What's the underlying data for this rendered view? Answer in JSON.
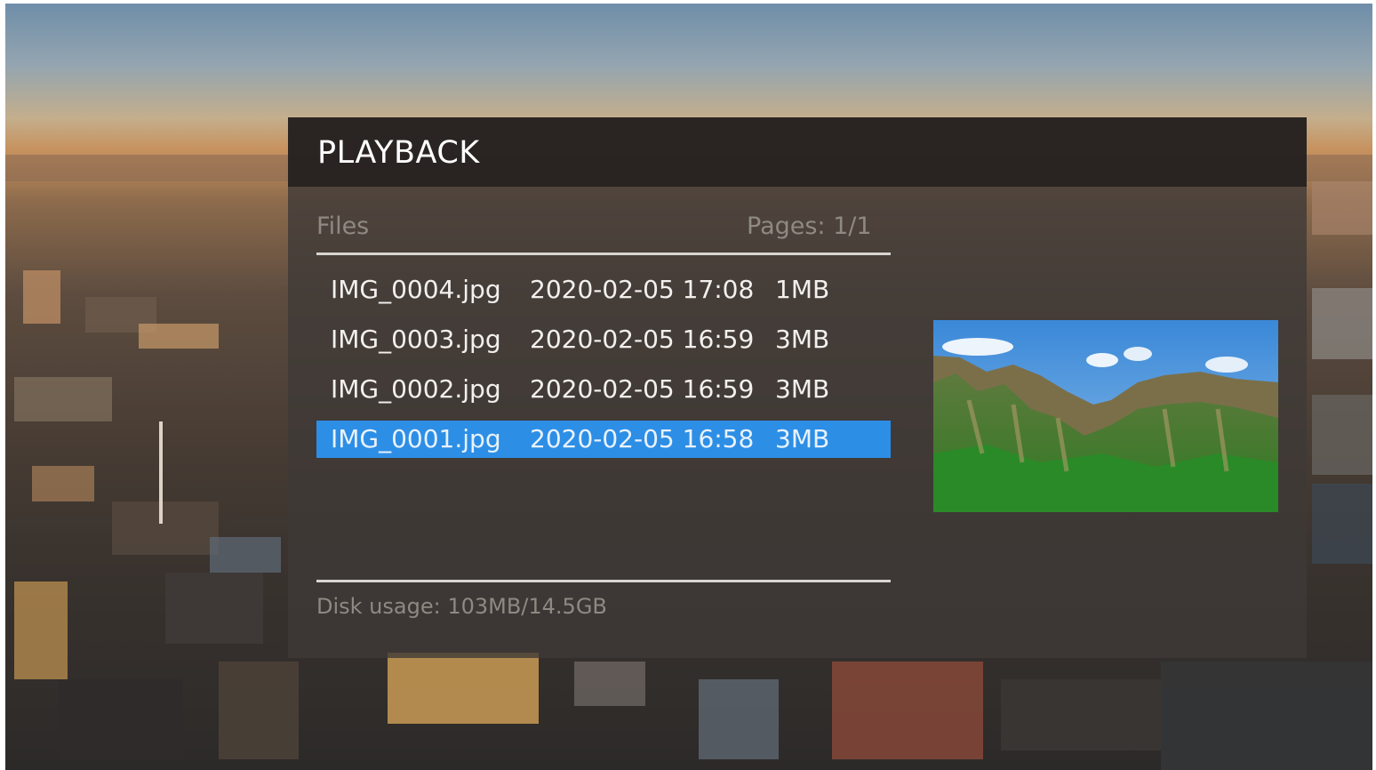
{
  "header": {
    "title": "PLAYBACK"
  },
  "list_header": {
    "files_label": "Files",
    "pages_label": "Pages: 1/1"
  },
  "files": [
    {
      "name": "IMG_0004.jpg",
      "date": "2020-02-05 17:08",
      "size": "1MB",
      "selected": false
    },
    {
      "name": "IMG_0003.jpg",
      "date": "2020-02-05 16:59",
      "size": "3MB",
      "selected": false
    },
    {
      "name": "IMG_0002.jpg",
      "date": "2020-02-05 16:59",
      "size": "3MB",
      "selected": false
    },
    {
      "name": "IMG_0001.jpg",
      "date": "2020-02-05 16:58",
      "size": "3MB",
      "selected": true
    }
  ],
  "footer": {
    "disk_usage": "Disk usage: 103MB/14.5GB"
  },
  "colors": {
    "selection": "#2d8ee6",
    "panel": "#3e3a37",
    "header": "#262220"
  }
}
